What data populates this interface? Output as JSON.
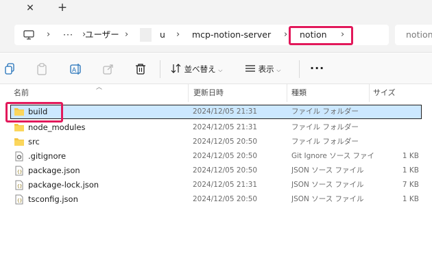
{
  "tabbar": {
    "close_icon": "close-icon",
    "new_tab_icon": "plus-icon"
  },
  "address": {
    "segments": [
      "ユーザー",
      "u",
      "mcp-notion-server",
      "notion"
    ],
    "ellipsis": "···",
    "search_text": "notion"
  },
  "toolbar": {
    "sort_label": "並べ替え",
    "view_label": "表示",
    "more_label": "···"
  },
  "columns": {
    "name": "名前",
    "date": "更新日時",
    "type": "種類",
    "size": "サイズ"
  },
  "files": [
    {
      "name": "build",
      "date": "2024/12/05 21:31",
      "type": "ファイル フォルダー",
      "size": "",
      "icon": "folder-icon"
    },
    {
      "name": "node_modules",
      "date": "2024/12/05 21:31",
      "type": "ファイル フォルダー",
      "size": "",
      "icon": "folder-icon"
    },
    {
      "name": "src",
      "date": "2024/12/05 20:50",
      "type": "ファイル フォルダー",
      "size": "",
      "icon": "folder-icon"
    },
    {
      "name": ".gitignore",
      "date": "2024/12/05 20:50",
      "type": "Git Ignore ソース ファイル",
      "size": "1 KB",
      "icon": "gitignore-file-icon"
    },
    {
      "name": "package.json",
      "date": "2024/12/05 20:50",
      "type": "JSON ソース ファイル",
      "size": "1 KB",
      "icon": "json-file-icon"
    },
    {
      "name": "package-lock.json",
      "date": "2024/12/05 21:31",
      "type": "JSON ソース ファイル",
      "size": "7 KB",
      "icon": "json-file-icon"
    },
    {
      "name": "tsconfig.json",
      "date": "2024/12/05 20:50",
      "type": "JSON ソース ファイル",
      "size": "1 KB",
      "icon": "json-file-icon"
    }
  ],
  "colors": {
    "highlight": "#e2185a",
    "selection": "#cce8ff",
    "folder": "#f4c542"
  }
}
